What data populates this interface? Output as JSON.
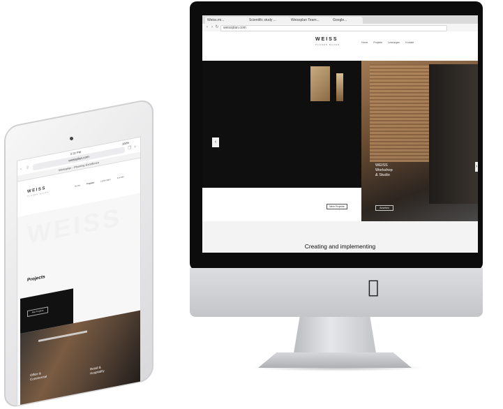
{
  "imac": {
    "browser_tabs": [
      "Weiss.mi...",
      "Scientific study ...",
      "Weissplan Team...",
      "Google..."
    ],
    "url": "weissplan.com",
    "site": {
      "logo": "WEISS",
      "logo_sub": "PLANEN BAUEN",
      "nav": [
        "Home",
        "Projekte",
        "Leistungen",
        "Kontakt"
      ],
      "hero_title_lines": [
        "WEISS",
        "Workshop",
        "& Studio"
      ],
      "button_more": "Mehr Projekte",
      "button_view": "Ansehen",
      "tagline": "Creating and implementing",
      "arrow_left": "‹",
      "arrow_right": "›"
    },
    "apple_logo": "apple-logo-icon"
  },
  "ipad": {
    "status_time": "2:22 PM",
    "status_battery": "100%",
    "url": "weissplan.com",
    "tab_title": "Weissplan - Planning Excellence",
    "site": {
      "logo": "WEISS",
      "logo_sub": "PLANEN BAUEN",
      "nav": [
        "Home",
        "Projekte",
        "Leistungen",
        "Kontakt"
      ],
      "ghost_text": "WEISS",
      "projects_title": "Projects",
      "projects_button": "Alle Projekte",
      "card_left": [
        "Office &",
        "Commercial"
      ],
      "card_right": [
        "Retail &",
        "Hospitality"
      ]
    }
  }
}
